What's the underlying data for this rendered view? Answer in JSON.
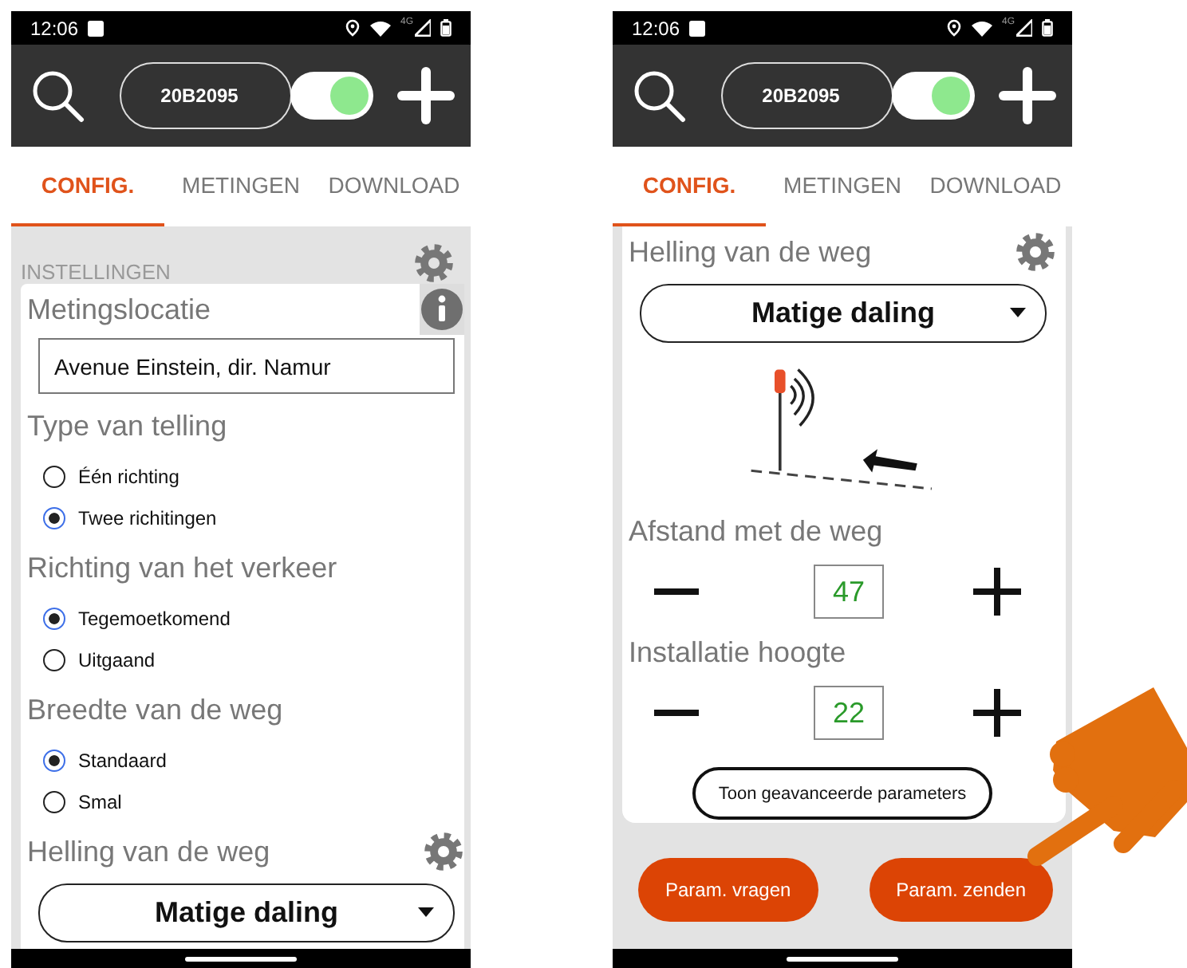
{
  "phones": [
    {
      "status_bar": {
        "time": "12:06",
        "network": "4G"
      },
      "header": {
        "device": "20B2095",
        "toggle_on": true
      },
      "tabs": [
        {
          "label": "CONFIG.",
          "selected": true
        },
        {
          "label": "METINGEN",
          "selected": false
        },
        {
          "label": "DOWNLOAD",
          "selected": false
        }
      ],
      "panel_title": "INSTELLINGEN",
      "blocks": [
        {
          "kind": "heading_info",
          "text": "Metingslocatie"
        },
        {
          "kind": "field",
          "value": "Avenue Einstein, dir. Namur"
        },
        {
          "kind": "heading",
          "text": "Type van telling"
        },
        {
          "kind": "radio_group",
          "options": [
            {
              "label": "Één richting",
              "selected": false
            },
            {
              "label": "Twee richitingen",
              "selected": true
            }
          ]
        },
        {
          "kind": "heading",
          "text": "Richting van het verkeer"
        },
        {
          "kind": "radio_group",
          "options": [
            {
              "label": "Tegemoetkomend",
              "selected": true
            },
            {
              "label": "Uitgaand",
              "selected": false
            }
          ]
        },
        {
          "kind": "heading",
          "text": "Breedte van de weg"
        },
        {
          "kind": "radio_group",
          "options": [
            {
              "label": "Standaard",
              "selected": true
            },
            {
              "label": "Smal",
              "selected": false
            }
          ]
        },
        {
          "kind": "heading_settings",
          "text": "Helling van de weg"
        },
        {
          "kind": "dropdown",
          "value": "Matige daling"
        }
      ]
    },
    {
      "status_bar": {
        "time": "12:06",
        "network": "4G"
      },
      "header": {
        "device": "20B2095",
        "toggle_on": true
      },
      "tabs": [
        {
          "label": "CONFIG.",
          "selected": true
        },
        {
          "label": "METINGEN",
          "selected": false
        },
        {
          "label": "DOWNLOAD",
          "selected": false
        }
      ],
      "blocks": [
        {
          "kind": "heading_settings",
          "text": "Helling van de weg"
        },
        {
          "kind": "dropdown",
          "value": "Matige daling"
        },
        {
          "kind": "diagram"
        },
        {
          "kind": "heading",
          "text": "Afstand met de weg"
        },
        {
          "kind": "stepper",
          "value": "47"
        },
        {
          "kind": "heading",
          "text": "Installatie hoogte"
        },
        {
          "kind": "stepper",
          "value": "22"
        },
        {
          "kind": "button",
          "label": "Toon geavanceerde parameters"
        }
      ],
      "footer_buttons": [
        "Param. vragen",
        "Param. zenden"
      ]
    }
  ]
}
